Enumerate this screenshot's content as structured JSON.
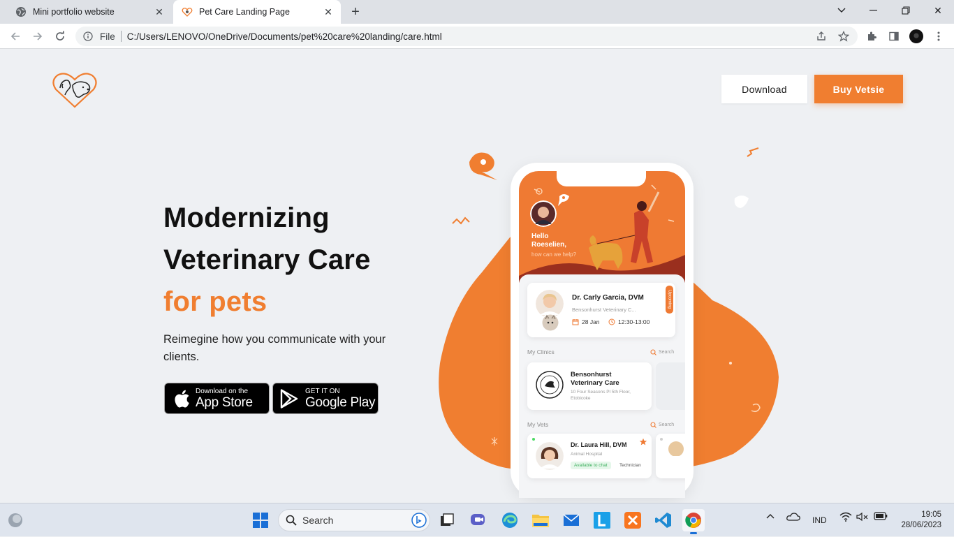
{
  "browser": {
    "tabs": [
      {
        "title": "Mini portfolio website",
        "active": false
      },
      {
        "title": "Pet Care Landing Page",
        "active": true
      }
    ],
    "address": {
      "scheme_label": "File",
      "url": "C:/Users/LENOVO/OneDrive/Documents/pet%20care%20landing/care.html"
    }
  },
  "page": {
    "header": {
      "download_label": "Download",
      "buy_label": "Buy Vetsie"
    },
    "hero": {
      "line1": "Modernizing",
      "line2": "Veterinary Care",
      "line3": "for pets",
      "subtext": "Reimegine how you communicate with your clients."
    },
    "stores": {
      "apple": {
        "small": "Download on the",
        "big": "App Store"
      },
      "google": {
        "small": "GET IT ON",
        "big": "Google Play"
      }
    },
    "phone": {
      "greeting_line1": "Hello",
      "greeting_line2": "Roeselien,",
      "greeting_sub": "how can we help?",
      "appointment": {
        "doctor": "Dr. Carly Garcia, DVM",
        "clinic": "Bensonhurst Veterinary C...",
        "date": "28 Jan",
        "time": "12:30-13:00",
        "tag": "Upcoming"
      },
      "clinics_label": "My Clinics",
      "search_label": "Search",
      "clinic": {
        "name_line1": "Bensonhurst",
        "name_line2": "Veterinary Care",
        "addr_line1": "10 Four Seasons Pl 5th Floor,",
        "addr_line2": "Etobicoke"
      },
      "vets_label": "My Vets",
      "vet": {
        "name": "Dr. Laura Hill, DVM",
        "place": "Animal Hospital",
        "status": "Available to chat",
        "role": "Technician"
      }
    },
    "colors": {
      "accent": "#f07e30",
      "dark": "#111111"
    }
  },
  "taskbar": {
    "search_label": "Search",
    "tray": {
      "language": "IND"
    },
    "clock": {
      "time": "19:05",
      "date": "28/06/2023"
    }
  }
}
